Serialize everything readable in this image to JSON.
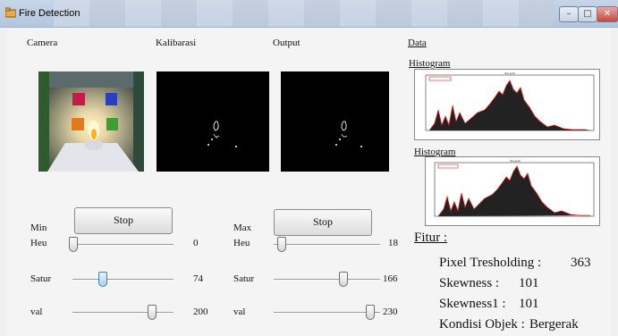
{
  "window": {
    "title": "Fire Detection",
    "minimize": "–",
    "maximize": "□",
    "close": "✕"
  },
  "labels": {
    "camera": "Camera",
    "kalibrasi": "Kalibarasi",
    "output": "Output",
    "data": "Data",
    "histogram1": "Histogram",
    "histogram2": "Histogram",
    "fitur": "Fitur :"
  },
  "controls": {
    "min": {
      "label": "Min",
      "button": "Stop",
      "sliders": [
        {
          "name": "Heu",
          "value": "0",
          "fraction": 0.0
        },
        {
          "name": "Satur",
          "value": "74",
          "fraction": 0.29
        },
        {
          "name": "val",
          "value": "200",
          "fraction": 0.78
        }
      ]
    },
    "max": {
      "label": "Max",
      "button": "Stop",
      "sliders": [
        {
          "name": "Heu",
          "value": "18",
          "fraction": 0.07
        },
        {
          "name": "Satur",
          "value": "166",
          "fraction": 0.65
        },
        {
          "name": "val",
          "value": "230",
          "fraction": 0.9
        }
      ]
    }
  },
  "fitur": {
    "pixel": {
      "label": "Pixel Tresholding :",
      "value": "363"
    },
    "skewness": {
      "label": "Skewness :",
      "value": "101"
    },
    "skewness1": {
      "label": "Skewness1 :",
      "value": "101"
    },
    "kondisi": {
      "label": "Kondisi Objek :",
      "value": "Bergerak"
    }
  },
  "colors": {
    "histogram_line": "#e02020",
    "histogram_fill": "#222222",
    "slider_blue": "#a9d1ee"
  }
}
